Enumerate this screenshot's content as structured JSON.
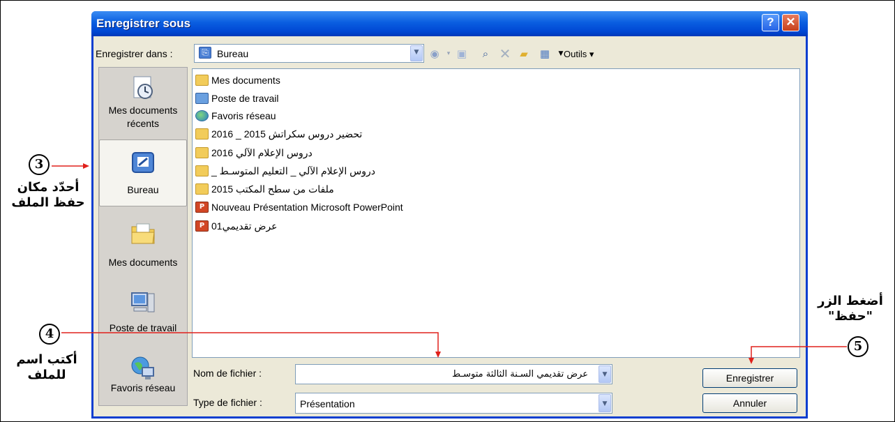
{
  "dialog": {
    "title": "Enregistrer sous",
    "help_glyph": "?",
    "close_glyph": "✕"
  },
  "toolbar": {
    "save_in_label": "Enregistrer dans :",
    "location": "Bureau",
    "tools_label": "Outils ▾",
    "icons": [
      "back-icon",
      "up-folder-icon",
      "search-web-icon",
      "delete-icon",
      "new-folder-icon",
      "views-icon"
    ]
  },
  "places": [
    {
      "label_1": "Mes documents",
      "label_2": "récents",
      "icon": "recent-documents-icon"
    },
    {
      "label_1": "Bureau",
      "label_2": "",
      "icon": "desktop-icon"
    },
    {
      "label_1": "Mes documents",
      "label_2": "",
      "icon": "my-documents-icon"
    },
    {
      "label_1": "Poste de travail",
      "label_2": "",
      "icon": "my-computer-icon"
    },
    {
      "label_1": "Favoris réseau",
      "label_2": "",
      "icon": "network-places-icon"
    }
  ],
  "files": [
    {
      "name": "Mes documents",
      "icon": "my-documents-icon"
    },
    {
      "name": "Poste de travail",
      "icon": "my-computer-icon"
    },
    {
      "name": "Favoris réseau",
      "icon": "network-places-icon"
    },
    {
      "name": "تحضير دروس سكراتش 2015 _ 2016",
      "icon": "folder-icon"
    },
    {
      "name": "دروس الإعلام الآلي 2016",
      "icon": "folder-icon"
    },
    {
      "name": "دروس الإعلام الآلي _ التعليم المتوسـط _",
      "icon": "folder-icon"
    },
    {
      "name": "ملفات من سطح المكتب 2015",
      "icon": "folder-icon"
    },
    {
      "name": "Nouveau Présentation Microsoft PowerPoint",
      "icon": "powerpoint-file-icon"
    },
    {
      "name": "عرض تقديمي01",
      "icon": "powerpoint-file-icon"
    }
  ],
  "form": {
    "filename_label": "Nom de fichier :",
    "filename_value": "عرض تقديمي السـنة الثالثة متوسـط",
    "filetype_label": "Type de fichier :",
    "filetype_value": "Présentation",
    "save_button": "Enregistrer",
    "cancel_button": "Annuler"
  },
  "annotations": {
    "step3_number": "3",
    "step3_line1": "أحدّد مكان",
    "step3_line2": "حفظ الملف",
    "step4_number": "4",
    "step4_line1": "أكتب اسم",
    "step4_line2": "للملف",
    "step5_number": "5",
    "step5_line1": "أضغط الزر",
    "step5_line2": "\"حفظ\""
  },
  "colors": {
    "annotation_arrow": "#e0201b",
    "titlebar": "#0a5ee0"
  }
}
